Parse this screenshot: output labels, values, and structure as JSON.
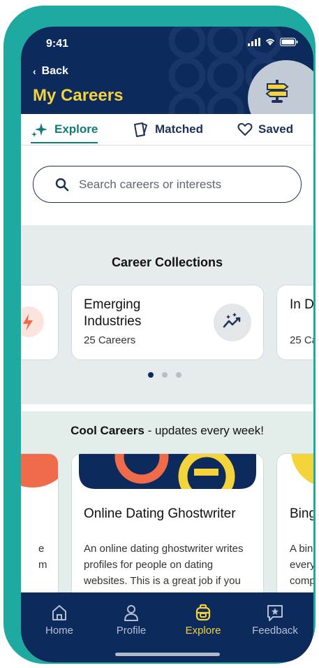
{
  "status": {
    "time": "9:41"
  },
  "header": {
    "back_label": "Back",
    "title": "My Careers"
  },
  "tabs": [
    {
      "label": "Explore",
      "active": true
    },
    {
      "label": "Matched",
      "active": false
    },
    {
      "label": "Saved",
      "active": false
    }
  ],
  "search": {
    "placeholder": "Search careers or interests",
    "value": ""
  },
  "collections": {
    "title": "Career Collections",
    "cards": [
      {
        "title": "",
        "count": "",
        "icon": "lightning-icon"
      },
      {
        "title": "Emerging Industries",
        "count": "25 Careers",
        "icon": "trending-up-sparkle-icon"
      },
      {
        "title": "In D",
        "count": "25 Ca",
        "icon": ""
      }
    ],
    "pagination": {
      "pages": 3,
      "active": 0
    }
  },
  "cool_careers": {
    "title": "Cool Careers",
    "subtitle": "- updates every week!",
    "cards": [
      {
        "title": "",
        "desc_lines": [
          "e",
          "m"
        ]
      },
      {
        "title": "Online Dating Ghostwriter",
        "desc_lines": [
          "An online dating ghostwriter writes",
          "profiles for people on dating",
          "websites. This is a great job if you"
        ]
      },
      {
        "title": "Bing",
        "desc_lines": [
          "A bin",
          "every",
          "comp"
        ]
      }
    ]
  },
  "nav": [
    {
      "label": "Home",
      "icon": "home-icon",
      "active": false
    },
    {
      "label": "Profile",
      "icon": "profile-icon",
      "active": false
    },
    {
      "label": "Explore",
      "icon": "explore-icon",
      "active": true
    },
    {
      "label": "Feedback",
      "icon": "feedback-icon",
      "active": false
    }
  ],
  "colors": {
    "navy": "#0d2a5c",
    "teal": "#1eaaa0",
    "accent_yellow": "#f5d33a",
    "tab_active": "#0f7c77",
    "orange": "#ef6b4a"
  }
}
